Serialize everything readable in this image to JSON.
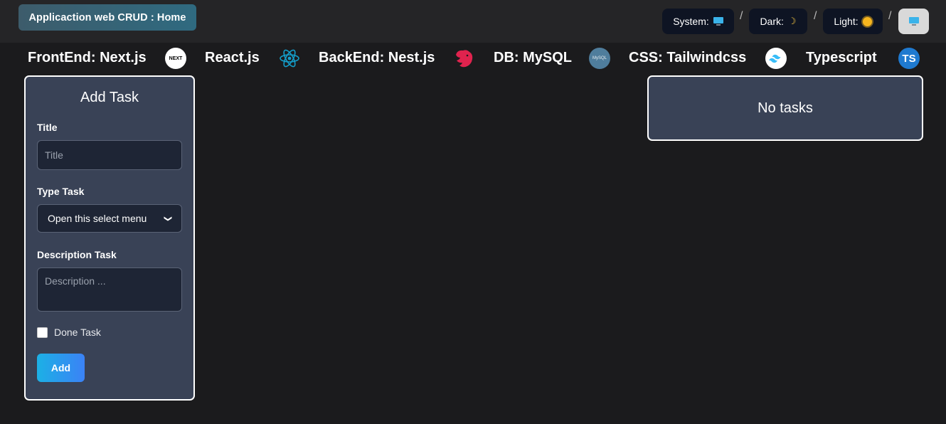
{
  "header": {
    "home_label": "Applicaction web CRUD : Home",
    "theme": {
      "system_label": "System:",
      "dark_label": "Dark:",
      "light_label": "Light:",
      "separator": "/",
      "system_icon": "monitor-icon",
      "dark_icon": "moon-icon",
      "light_icon": "sun-icon"
    }
  },
  "tech_stack": [
    {
      "label": "FrontEnd: Next.js",
      "icon": "nextjs-icon",
      "icon_text": "NEXT"
    },
    {
      "label": "React.js",
      "icon": "react-icon",
      "icon_text": ""
    },
    {
      "label": "BackEnd: Nest.js",
      "icon": "nestjs-icon",
      "icon_text": ""
    },
    {
      "label": "DB: MySQL",
      "icon": "mysql-icon",
      "icon_text": "MySQL"
    },
    {
      "label": "CSS: Tailwindcss",
      "icon": "tailwind-icon",
      "icon_text": ""
    },
    {
      "label": "Typescript",
      "icon": "typescript-icon",
      "icon_text": "TS"
    }
  ],
  "form": {
    "title": "Add Task",
    "title_label": "Title",
    "title_placeholder": "Title",
    "type_label": "Type Task",
    "type_selected": "Open this select menu",
    "description_label": "Description Task",
    "description_placeholder": "Description ...",
    "done_label": "Done Task",
    "done_checked": false,
    "submit_label": "Add"
  },
  "tasks": {
    "empty_message": "No tasks"
  },
  "colors": {
    "background": "#1b1b1d",
    "card": "#394256",
    "accent_start": "#1cb0e5",
    "accent_end": "#3b82f6",
    "nest_red": "#e0234e",
    "react_blue": "#149eca"
  }
}
